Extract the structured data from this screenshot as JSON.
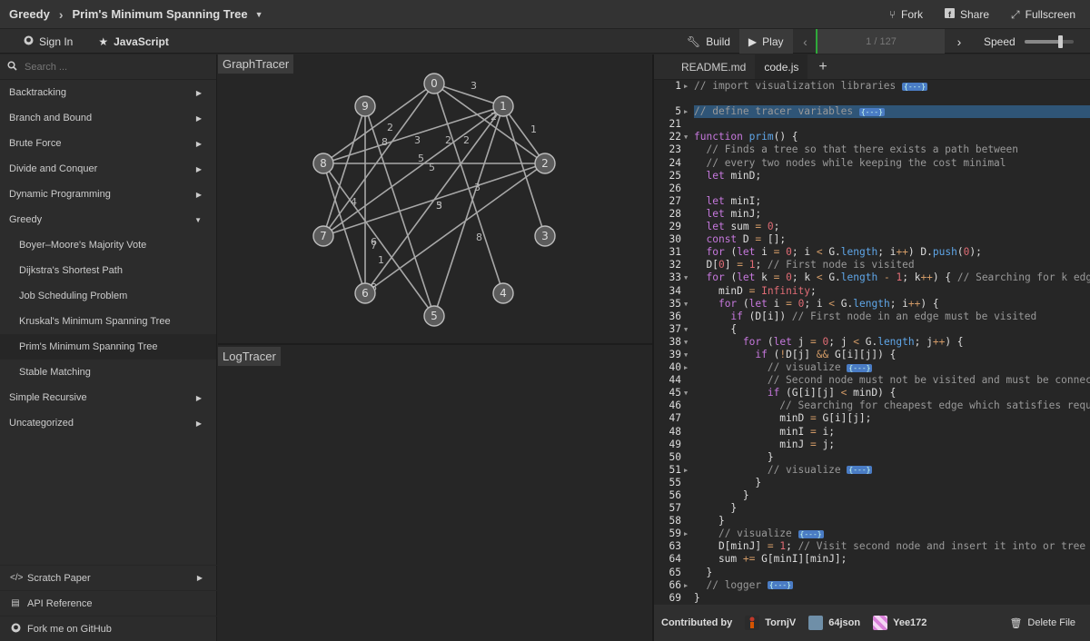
{
  "header": {
    "breadcrumb_root": "Greedy",
    "breadcrumb_current": "Prim's Minimum Spanning Tree",
    "actions": {
      "fork": "Fork",
      "share": "Share",
      "fullscreen": "Fullscreen"
    }
  },
  "subbar": {
    "sign_in": "Sign In",
    "language": "JavaScript",
    "build": "Build",
    "play": "Play",
    "progress": "1 / 127",
    "progress_fraction": 0.008,
    "speed_label": "Speed",
    "speed_level": 0.72
  },
  "sidebar": {
    "search_placeholder": "Search ...",
    "categories": [
      {
        "label": "Backtracking",
        "expanded": false
      },
      {
        "label": "Branch and Bound",
        "expanded": false
      },
      {
        "label": "Brute Force",
        "expanded": false
      },
      {
        "label": "Divide and Conquer",
        "expanded": false
      },
      {
        "label": "Dynamic Programming",
        "expanded": false
      },
      {
        "label": "Greedy",
        "expanded": true
      }
    ],
    "greedy_items": [
      "Boyer–Moore's Majority Vote",
      "Dijkstra's Shortest Path",
      "Job Scheduling Problem",
      "Kruskal's Minimum Spanning Tree",
      "Prim's Minimum Spanning Tree",
      "Stable Matching"
    ],
    "after_categories": [
      "Simple Recursive",
      "Uncategorized"
    ],
    "bottom": {
      "scratch": "Scratch Paper",
      "api": "API Reference",
      "github": "Fork me on GitHub"
    }
  },
  "graph_panel": {
    "label": "GraphTracer",
    "nodes": [
      "0",
      "1",
      "2",
      "3",
      "4",
      "5",
      "6",
      "7",
      "8",
      "9"
    ],
    "edge_labels": [
      "3",
      "1",
      "2",
      "3",
      "8",
      "5",
      "2",
      "3",
      "5",
      "7",
      "2",
      "8",
      "5",
      "3",
      "6",
      "8",
      "1",
      "2",
      "4"
    ]
  },
  "log_panel": {
    "label": "LogTracer"
  },
  "code_panel": {
    "tabs": [
      "README.md",
      "code.js"
    ],
    "active_tab": "code.js",
    "contributed_by": "Contributed by",
    "contributors": [
      "TornjV",
      "64json",
      "Yee172"
    ],
    "delete_file": "Delete File"
  },
  "code_lines": [
    {
      "n": "1",
      "fold": "r",
      "html": "<span class='cm'>// import visualization libraries </span><span class='fold-tag'>{---}</span>"
    },
    {
      "n": "",
      "html": ""
    },
    {
      "n": "5",
      "fold": "r",
      "hl": true,
      "html": "<span class='cm'>// define tracer variables </span><span class='fold-tag'>{---}</span>"
    },
    {
      "n": "21",
      "html": ""
    },
    {
      "n": "22",
      "fold": "d",
      "html": "<span class='kw'>function</span> <span class='fn'>prim</span>() {"
    },
    {
      "n": "23",
      "html": "  <span class='cm'>// Finds a tree so that there exists a path between</span>"
    },
    {
      "n": "24",
      "html": "  <span class='cm'>// every two nodes while keeping the cost minimal</span>"
    },
    {
      "n": "25",
      "html": "  <span class='kw'>let</span> minD;"
    },
    {
      "n": "26",
      "html": ""
    },
    {
      "n": "27",
      "html": "  <span class='kw'>let</span> minI;"
    },
    {
      "n": "28",
      "html": "  <span class='kw'>let</span> minJ;"
    },
    {
      "n": "29",
      "html": "  <span class='kw'>let</span> sum <span class='op'>=</span> <span class='num'>0</span>;"
    },
    {
      "n": "30",
      "html": "  <span class='kw'>const</span> D <span class='op'>=</span> [];"
    },
    {
      "n": "31",
      "html": "  <span class='kw'>for</span> (<span class='kw'>let</span> i <span class='op'>=</span> <span class='num'>0</span>; i <span class='op'>&lt;</span> G.<span class='fn'>length</span>; i<span class='op'>++</span>) D.<span class='fn'>push</span>(<span class='num'>0</span>);"
    },
    {
      "n": "32",
      "html": "  D[<span class='num'>0</span>] <span class='op'>=</span> <span class='num'>1</span>; <span class='cm'>// First node is visited</span>"
    },
    {
      "n": "33",
      "fold": "d",
      "html": "  <span class='kw'>for</span> (<span class='kw'>let</span> k <span class='op'>=</span> <span class='num'>0</span>; k <span class='op'>&lt;</span> G.<span class='fn'>length</span> <span class='op'>-</span> <span class='num'>1</span>; k<span class='op'>++</span>) { <span class='cm'>// Searching for k edges</span>"
    },
    {
      "n": "34",
      "html": "    minD <span class='op'>=</span> <span class='num'>Infinity</span>;"
    },
    {
      "n": "35",
      "fold": "d",
      "html": "    <span class='kw'>for</span> (<span class='kw'>let</span> i <span class='op'>=</span> <span class='num'>0</span>; i <span class='op'>&lt;</span> G.<span class='fn'>length</span>; i<span class='op'>++</span>) {"
    },
    {
      "n": "36",
      "html": "      <span class='kw'>if</span> (D[i]) <span class='cm'>// First node in an edge must be visited</span>"
    },
    {
      "n": "37",
      "fold": "d",
      "html": "      {"
    },
    {
      "n": "38",
      "fold": "d",
      "html": "        <span class='kw'>for</span> (<span class='kw'>let</span> j <span class='op'>=</span> <span class='num'>0</span>; j <span class='op'>&lt;</span> G.<span class='fn'>length</span>; j<span class='op'>++</span>) {"
    },
    {
      "n": "39",
      "fold": "d",
      "html": "          <span class='kw'>if</span> (<span class='op'>!</span>D[j] <span class='op'>&amp;&amp;</span> G[i][j]) {"
    },
    {
      "n": "40",
      "fold": "r",
      "html": "            <span class='cm'>// visualize </span><span class='fold-tag'>{---}</span>"
    },
    {
      "n": "44",
      "html": "            <span class='cm'>// Second node must not be visited and must be connected</span>"
    },
    {
      "n": "45",
      "fold": "d",
      "html": "            <span class='kw'>if</span> (G[i][j] <span class='op'>&lt;</span> minD) {"
    },
    {
      "n": "46",
      "html": "              <span class='cm'>// Searching for cheapest edge which satisfies requirem</span>"
    },
    {
      "n": "47",
      "html": "              minD <span class='op'>=</span> G[i][j];"
    },
    {
      "n": "48",
      "html": "              minI <span class='op'>=</span> i;"
    },
    {
      "n": "49",
      "html": "              minJ <span class='op'>=</span> j;"
    },
    {
      "n": "50",
      "html": "            }"
    },
    {
      "n": "51",
      "fold": "r",
      "html": "            <span class='cm'>// visualize </span><span class='fold-tag'>{---}</span>"
    },
    {
      "n": "55",
      "html": "          }"
    },
    {
      "n": "56",
      "html": "        }"
    },
    {
      "n": "57",
      "html": "      }"
    },
    {
      "n": "58",
      "html": "    }"
    },
    {
      "n": "59",
      "fold": "r",
      "html": "    <span class='cm'>// visualize </span><span class='fold-tag'>{---}</span>"
    },
    {
      "n": "63",
      "html": "    D[minJ] <span class='op'>=</span> <span class='num'>1</span>; <span class='cm'>// Visit second node and insert it into or tree</span>"
    },
    {
      "n": "64",
      "html": "    sum <span class='op'>+=</span> G[minI][minJ];"
    },
    {
      "n": "65",
      "html": "  }"
    },
    {
      "n": "66",
      "fold": "r",
      "html": "  <span class='cm'>// logger </span><span class='fold-tag'>{---}</span>"
    },
    {
      "n": "69",
      "html": "}"
    }
  ]
}
